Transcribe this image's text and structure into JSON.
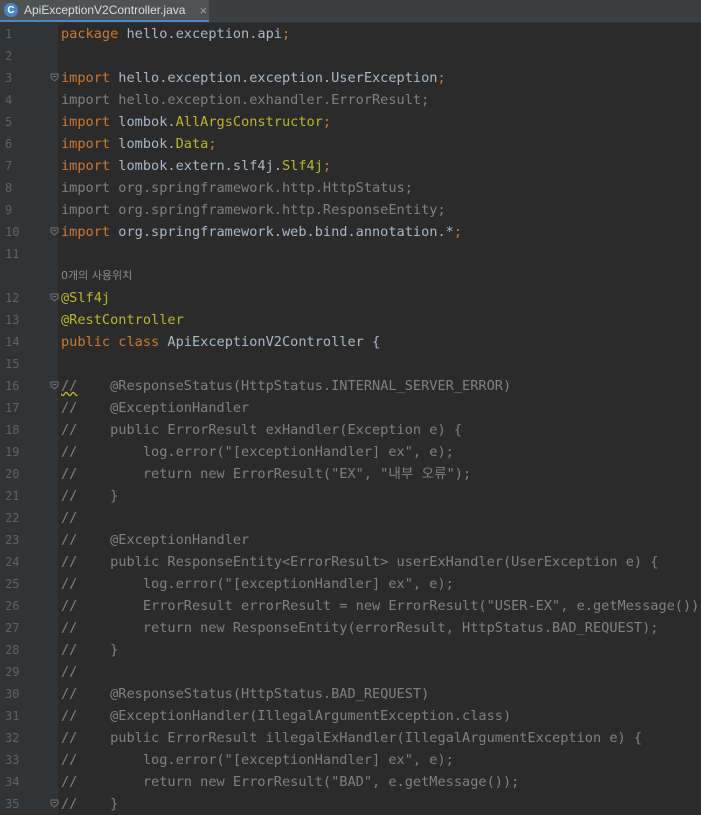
{
  "tab": {
    "file_icon_letter": "C",
    "file_name": "ApiExceptionV2Controller.java",
    "close_glyph": "×"
  },
  "inlay_hint": "0개의 사용위치",
  "colors": {
    "background": "#2b2b2b",
    "gutter": "#313335",
    "keyword": "#cc7832",
    "annotation": "#bbb529",
    "comment": "#808080",
    "text": "#a9b7c6",
    "tab_underline": "#4a88c7"
  },
  "lines": [
    {
      "n": "1",
      "fold": false,
      "segs": [
        {
          "t": "package",
          "c": "kw"
        },
        {
          "t": " hello.exception.api"
        },
        {
          "t": ";",
          "c": "kw"
        }
      ]
    },
    {
      "n": "2",
      "fold": false,
      "segs": []
    },
    {
      "n": "3",
      "fold": true,
      "segs": [
        {
          "t": "import",
          "c": "kw"
        },
        {
          "t": " hello.exception.exception.UserException"
        },
        {
          "t": ";",
          "c": "kw"
        }
      ]
    },
    {
      "n": "4",
      "fold": false,
      "segs": [
        {
          "t": "import hello.exception.exhandler.ErrorResult;",
          "c": "dim"
        }
      ]
    },
    {
      "n": "5",
      "fold": false,
      "segs": [
        {
          "t": "import",
          "c": "kw"
        },
        {
          "t": " lombok."
        },
        {
          "t": "AllArgsConstructor",
          "c": "ann"
        },
        {
          "t": ";",
          "c": "kw"
        }
      ]
    },
    {
      "n": "6",
      "fold": false,
      "segs": [
        {
          "t": "import",
          "c": "kw"
        },
        {
          "t": " lombok."
        },
        {
          "t": "Data",
          "c": "ann"
        },
        {
          "t": ";",
          "c": "kw"
        }
      ]
    },
    {
      "n": "7",
      "fold": false,
      "segs": [
        {
          "t": "import",
          "c": "kw"
        },
        {
          "t": " lombok.extern.slf4j."
        },
        {
          "t": "Slf4j",
          "c": "ann"
        },
        {
          "t": ";",
          "c": "kw"
        }
      ]
    },
    {
      "n": "8",
      "fold": false,
      "segs": [
        {
          "t": "import org.springframework.http.HttpStatus;",
          "c": "dim"
        }
      ]
    },
    {
      "n": "9",
      "fold": false,
      "segs": [
        {
          "t": "import org.springframework.http.ResponseEntity;",
          "c": "dim"
        }
      ]
    },
    {
      "n": "10",
      "fold": true,
      "segs": [
        {
          "t": "import",
          "c": "kw"
        },
        {
          "t": " org.springframework.web.bind.annotation.*"
        },
        {
          "t": ";",
          "c": "kw"
        }
      ]
    },
    {
      "n": "11",
      "fold": false,
      "segs": []
    },
    {
      "n": "",
      "hint": true,
      "fold": false,
      "segs": []
    },
    {
      "n": "12",
      "fold": true,
      "segs": [
        {
          "t": "@Slf4j",
          "c": "ann"
        }
      ]
    },
    {
      "n": "13",
      "fold": false,
      "segs": [
        {
          "t": "@RestController",
          "c": "ann"
        }
      ]
    },
    {
      "n": "14",
      "fold": false,
      "segs": [
        {
          "t": "public class",
          "c": "kw"
        },
        {
          "t": " ApiExceptionV2Controller {"
        }
      ]
    },
    {
      "n": "15",
      "fold": false,
      "segs": []
    },
    {
      "n": "16",
      "fold": true,
      "segs": [
        {
          "t": "//",
          "c": "err"
        },
        {
          "t": "    @ResponseStatus(HttpStatus.INTERNAL_SERVER_ERROR)",
          "c": "cmt"
        }
      ]
    },
    {
      "n": "17",
      "fold": false,
      "segs": [
        {
          "t": "//    @ExceptionHandler",
          "c": "cmt"
        }
      ]
    },
    {
      "n": "18",
      "fold": false,
      "segs": [
        {
          "t": "//    public ErrorResult exHandler(Exception e) {",
          "c": "cmt"
        }
      ]
    },
    {
      "n": "19",
      "fold": false,
      "segs": [
        {
          "t": "//        log.error(\"[exceptionHandler] ex\", e);",
          "c": "cmt"
        }
      ]
    },
    {
      "n": "20",
      "fold": false,
      "segs": [
        {
          "t": "//        return new ErrorResult(\"EX\", \"내부 오류\");",
          "c": "cmt"
        }
      ]
    },
    {
      "n": "21",
      "fold": false,
      "segs": [
        {
          "t": "//    }",
          "c": "cmt"
        }
      ]
    },
    {
      "n": "22",
      "fold": false,
      "segs": [
        {
          "t": "//",
          "c": "cmt"
        }
      ]
    },
    {
      "n": "23",
      "fold": false,
      "segs": [
        {
          "t": "//    @ExceptionHandler",
          "c": "cmt"
        }
      ]
    },
    {
      "n": "24",
      "fold": false,
      "segs": [
        {
          "t": "//    public ResponseEntity<ErrorResult> userExHandler(UserException e) {",
          "c": "cmt"
        }
      ]
    },
    {
      "n": "25",
      "fold": false,
      "segs": [
        {
          "t": "//        log.error(\"[exceptionHandler] ex\", e);",
          "c": "cmt"
        }
      ]
    },
    {
      "n": "26",
      "fold": false,
      "segs": [
        {
          "t": "//        ErrorResult errorResult = new ErrorResult(\"USER-EX\", e.getMessage());",
          "c": "cmt"
        }
      ]
    },
    {
      "n": "27",
      "fold": false,
      "segs": [
        {
          "t": "//        return new ResponseEntity(errorResult, HttpStatus.BAD_REQUEST);",
          "c": "cmt"
        }
      ]
    },
    {
      "n": "28",
      "fold": false,
      "segs": [
        {
          "t": "//    }",
          "c": "cmt"
        }
      ]
    },
    {
      "n": "29",
      "fold": false,
      "segs": [
        {
          "t": "//",
          "c": "cmt"
        }
      ]
    },
    {
      "n": "30",
      "fold": false,
      "segs": [
        {
          "t": "//    @ResponseStatus(HttpStatus.BAD_REQUEST)",
          "c": "cmt"
        }
      ]
    },
    {
      "n": "31",
      "fold": false,
      "segs": [
        {
          "t": "//    @ExceptionHandler(IllegalArgumentException.class)",
          "c": "cmt"
        }
      ]
    },
    {
      "n": "32",
      "fold": false,
      "segs": [
        {
          "t": "//    public ErrorResult illegalExHandler(IllegalArgumentException e) {",
          "c": "cmt"
        }
      ]
    },
    {
      "n": "33",
      "fold": false,
      "segs": [
        {
          "t": "//        log.error(\"[exceptionHandler] ex\", e);",
          "c": "cmt"
        }
      ]
    },
    {
      "n": "34",
      "fold": false,
      "segs": [
        {
          "t": "//        return new ErrorResult(\"BAD\", e.getMessage());",
          "c": "cmt"
        }
      ]
    },
    {
      "n": "35",
      "fold": true,
      "segs": [
        {
          "t": "//    }",
          "c": "cmt"
        }
      ]
    }
  ]
}
